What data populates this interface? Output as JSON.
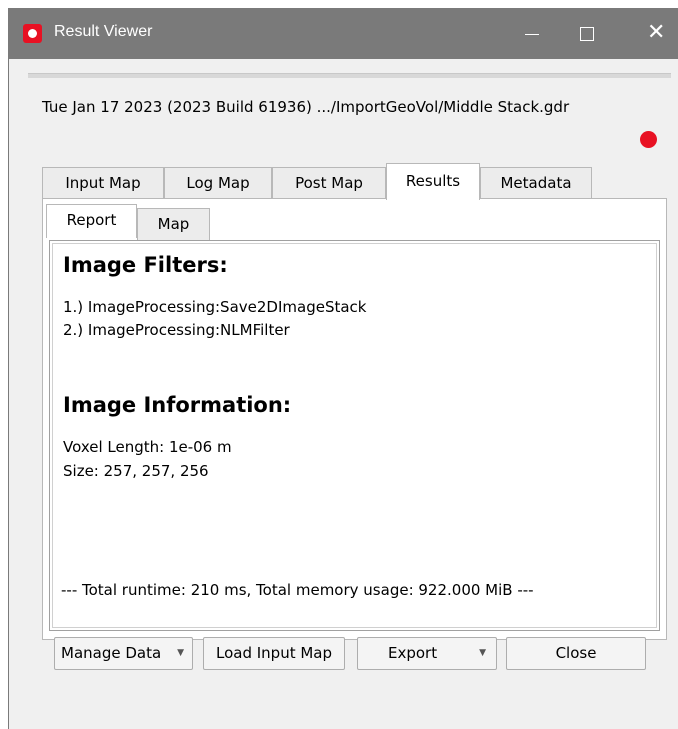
{
  "window": {
    "title": "Result Viewer",
    "close_glyph": "✕"
  },
  "header": {
    "splitter_dots": "........",
    "info_line": "Tue Jan 17 2023 (2023 Build 61936)    .../ImportGeoVol/Middle Stack.gdr",
    "status_color": "#e81123"
  },
  "tabs": [
    "Input Map",
    "Log Map",
    "Post Map",
    "Results",
    "Metadata"
  ],
  "active_tab": "Results",
  "subtabs": [
    "Report",
    "Map"
  ],
  "active_subtab": "Report",
  "report": {
    "filters_heading": "Image Filters:",
    "filters": [
      "1.) ImageProcessing:Save2DImageStack",
      "2.) ImageProcessing:NLMFilter"
    ],
    "info_heading": "Image Information:",
    "info": [
      "Voxel Length: 1e-06 m",
      "Size: 257, 257, 256"
    ],
    "footer": "--- Total runtime: 210 ms, Total memory usage: 922.000 MiB ---"
  },
  "buttons": {
    "manage_data": "Manage Data",
    "load_input_map": "Load Input Map",
    "export": "Export",
    "close": "Close",
    "caret": "▼"
  }
}
